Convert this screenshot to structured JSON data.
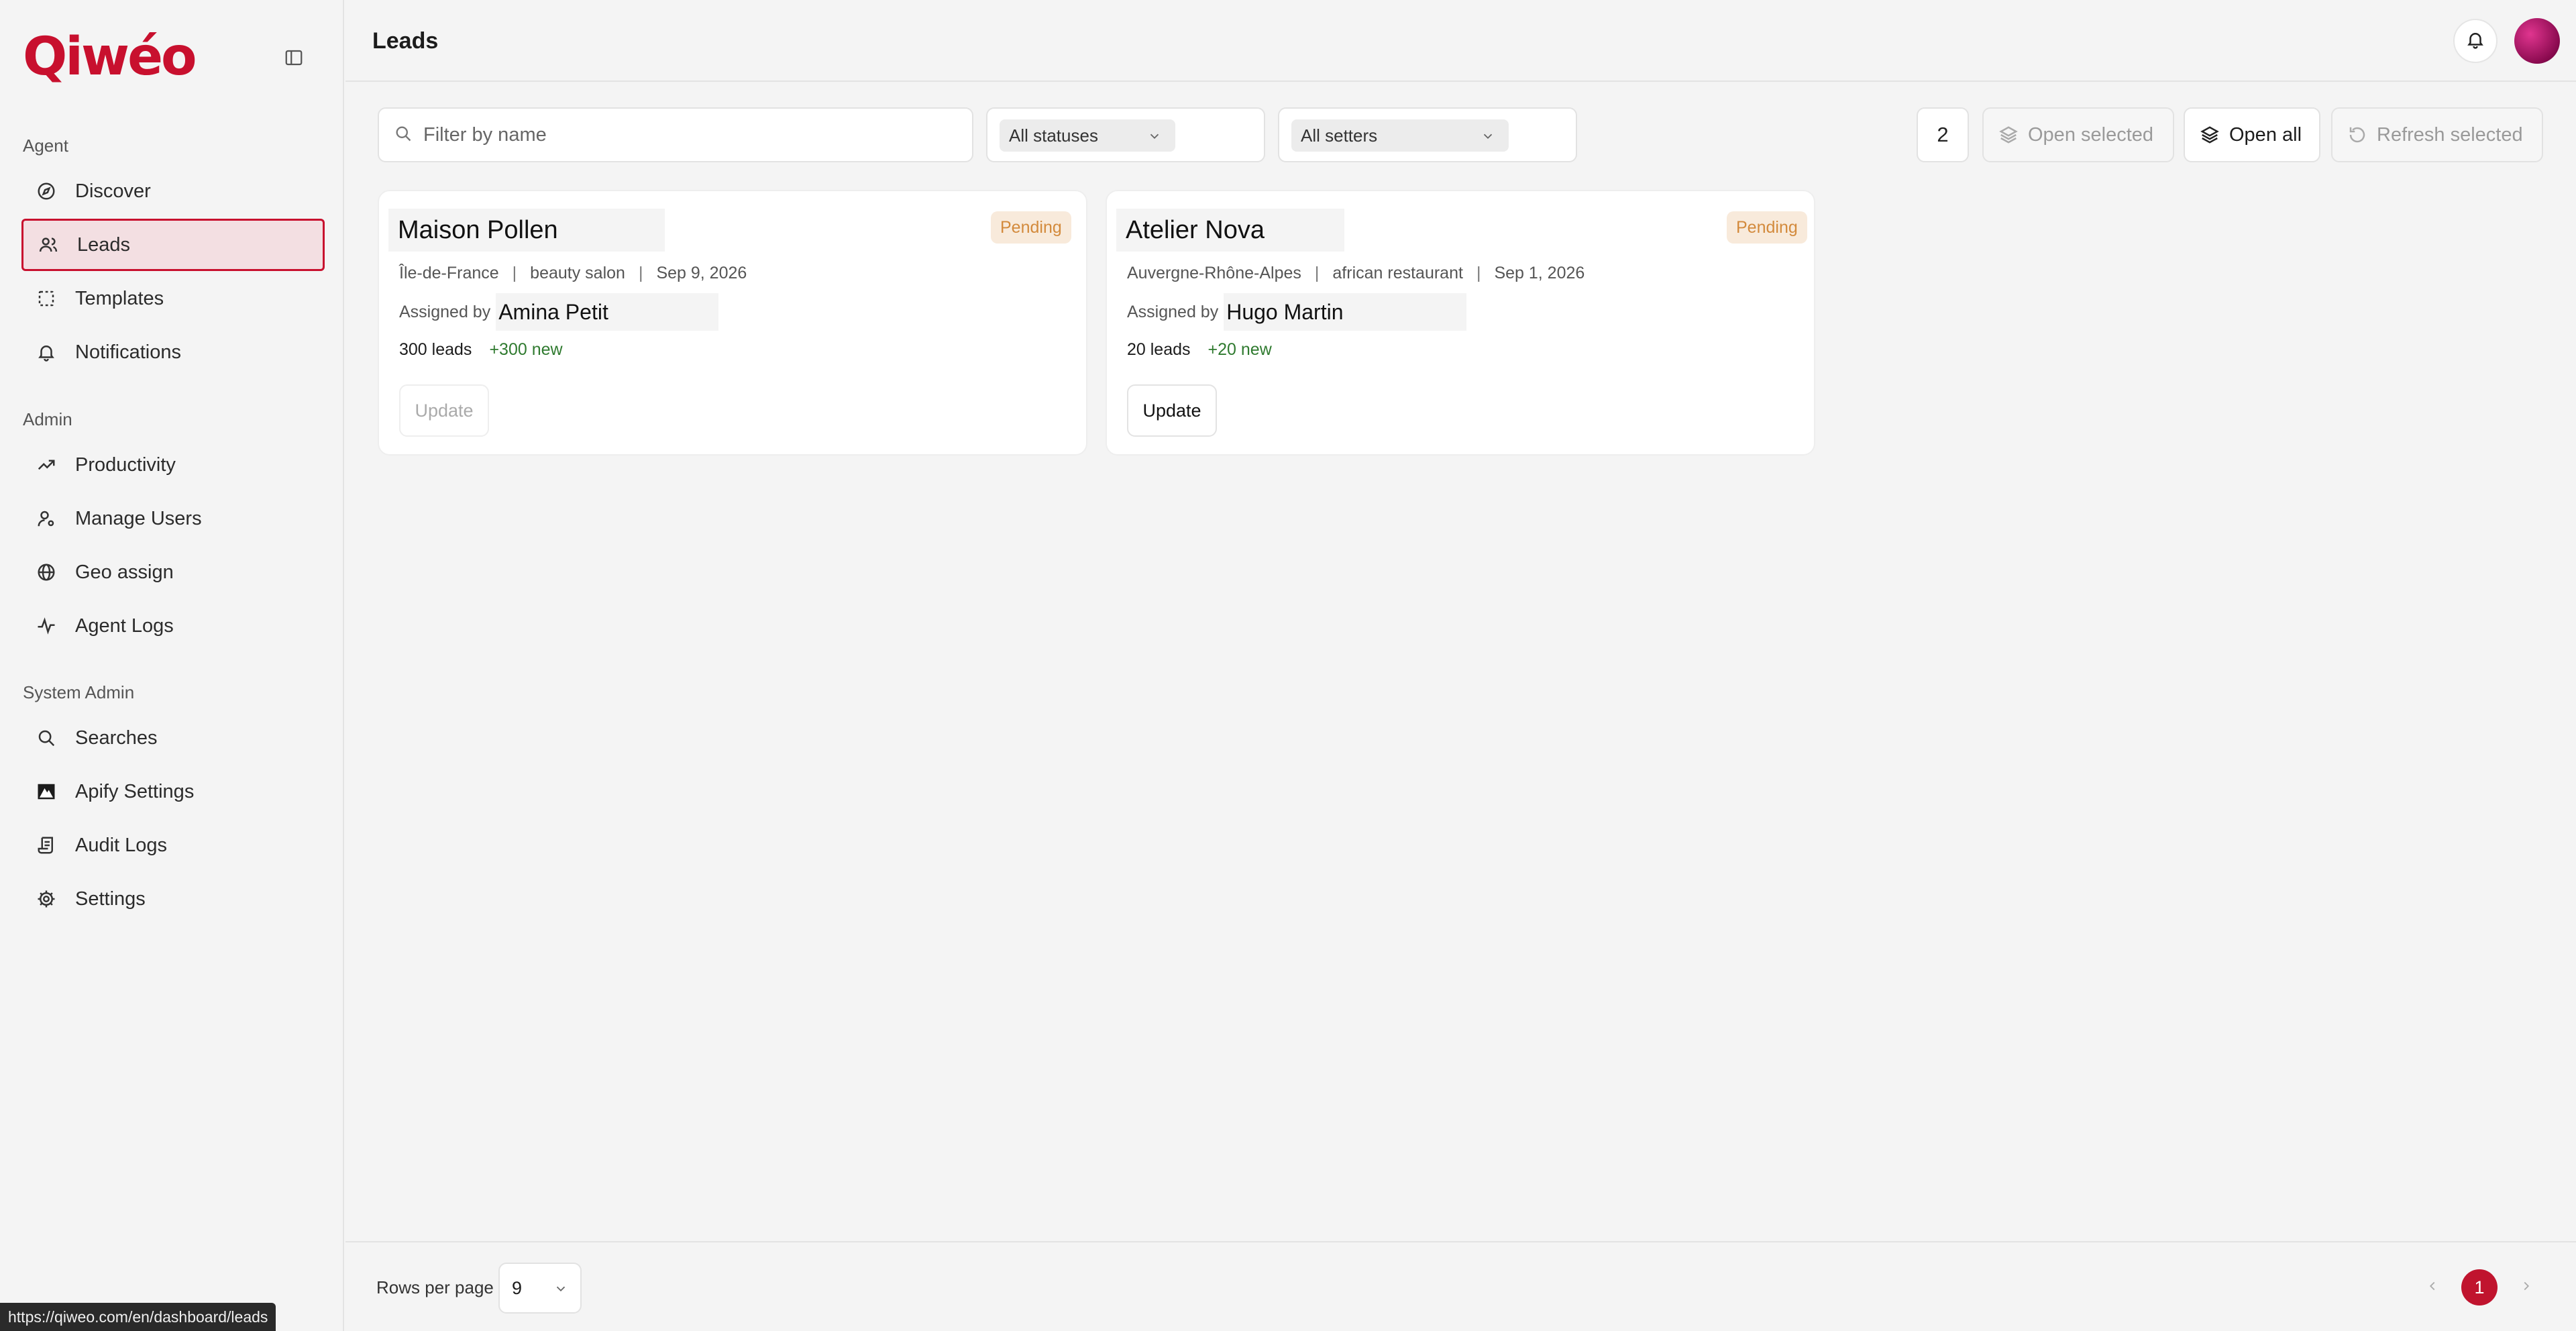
{
  "app": {
    "logo_text": "Qiwéo"
  },
  "header": {
    "title": "Leads"
  },
  "sidebar": {
    "groups": [
      {
        "label": "Agent",
        "items": [
          {
            "label": "Discover",
            "icon": "compass-icon"
          },
          {
            "label": "Leads",
            "icon": "users-icon",
            "active": true
          },
          {
            "label": "Templates",
            "icon": "dashed-square-icon"
          },
          {
            "label": "Notifications",
            "icon": "bell-icon"
          }
        ]
      },
      {
        "label": "Admin",
        "items": [
          {
            "label": "Productivity",
            "icon": "trending-up-icon"
          },
          {
            "label": "Manage Users",
            "icon": "user-cog-icon"
          },
          {
            "label": "Geo assign",
            "icon": "globe-icon"
          },
          {
            "label": "Agent Logs",
            "icon": "activity-icon"
          }
        ]
      },
      {
        "label": "System Admin",
        "items": [
          {
            "label": "Searches",
            "icon": "search-icon"
          },
          {
            "label": "Apify Settings",
            "icon": "apify-icon"
          },
          {
            "label": "Audit Logs",
            "icon": "scroll-icon"
          },
          {
            "label": "Settings",
            "icon": "gear-icon"
          }
        ]
      }
    ]
  },
  "filters": {
    "search_placeholder": "Filter by name",
    "status_select": "All statuses",
    "setter_select": "All setters",
    "selected_count": "2",
    "open_selected": "Open selected",
    "open_all": "Open all",
    "refresh_selected": "Refresh selected"
  },
  "cards": [
    {
      "title": "Maison Pollen",
      "status": "Pending",
      "region": "Île-de-France",
      "category": "beauty salon",
      "date": "Sep 9, 2026",
      "assigned_label": "Assigned by",
      "assignee": "Amina Petit",
      "leads": "300 leads",
      "new": "+300 new",
      "update_label": "Update",
      "update_enabled": false
    },
    {
      "title": "Atelier Nova",
      "status": "Pending",
      "region": "Auvergne-Rhône-Alpes",
      "category": "african restaurant",
      "date": "Sep 1, 2026",
      "assigned_label": "Assigned by",
      "assignee": "Hugo Martin",
      "leads": "20 leads",
      "new": "+20 new",
      "update_label": "Update",
      "update_enabled": true
    }
  ],
  "footer": {
    "rows_label": "Rows per page",
    "rows_value": "9",
    "current_page": "1"
  },
  "status_bar_url": "https://qiweo.com/en/dashboard/leads",
  "colors": {
    "brand": "#c8102e",
    "pending_text": "#d38a3c",
    "pending_bg": "#f8eadb",
    "new_text": "#2f7a2f"
  }
}
